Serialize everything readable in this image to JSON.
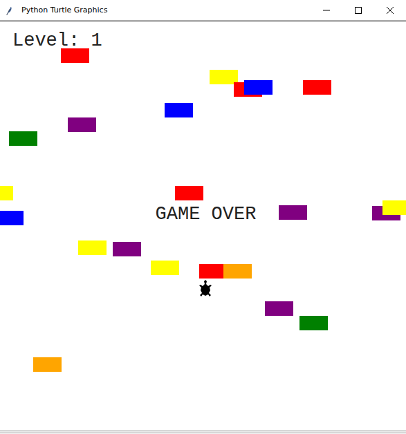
{
  "window": {
    "title": "Python Turtle Graphics"
  },
  "hud": {
    "level": "Level: 1",
    "message": "GAME OVER"
  },
  "cars": [
    {
      "color": "#ff0000"
    },
    {
      "color": "#ffff00"
    },
    {
      "color": "#ff0000"
    },
    {
      "color": "#0000ff"
    },
    {
      "color": "#ff0000"
    },
    {
      "color": "#0000ff"
    },
    {
      "color": "#800080"
    },
    {
      "color": "#008000"
    },
    {
      "color": "#ffff00"
    },
    {
      "color": "#ff0000"
    },
    {
      "color": "#0000ff"
    },
    {
      "color": "#800080"
    },
    {
      "color": "#800080"
    },
    {
      "color": "#ffff00"
    },
    {
      "color": "#ffff00"
    },
    {
      "color": "#800080"
    },
    {
      "color": "#ffff00"
    },
    {
      "color": "#ff0000"
    },
    {
      "color": "#ffa500"
    },
    {
      "color": "#800080"
    },
    {
      "color": "#008000"
    },
    {
      "color": "#ffa500"
    }
  ]
}
